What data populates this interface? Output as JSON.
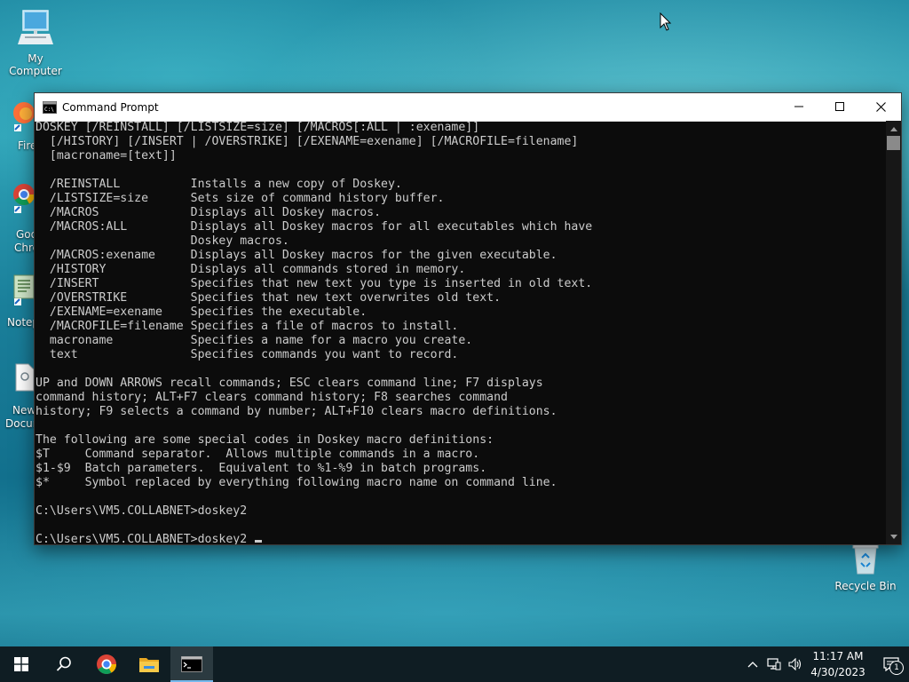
{
  "desktop": {
    "icons": [
      {
        "label": "My Computer"
      },
      {
        "label": "Recycle Bin"
      }
    ],
    "partial_labels": [
      "Fire",
      "Goo",
      "Chro",
      "Notep",
      "New",
      "Docun"
    ]
  },
  "window": {
    "title": "Command Prompt",
    "console_lines": [
      "DOSKEY [/REINSTALL] [/LISTSIZE=size] [/MACROS[:ALL | :exename]]",
      "  [/HISTORY] [/INSERT | /OVERSTRIKE] [/EXENAME=exename] [/MACROFILE=filename]",
      "  [macroname=[text]]",
      "",
      "  /REINSTALL          Installs a new copy of Doskey.",
      "  /LISTSIZE=size      Sets size of command history buffer.",
      "  /MACROS             Displays all Doskey macros.",
      "  /MACROS:ALL         Displays all Doskey macros for all executables which have",
      "                      Doskey macros.",
      "  /MACROS:exename     Displays all Doskey macros for the given executable.",
      "  /HISTORY            Displays all commands stored in memory.",
      "  /INSERT             Specifies that new text you type is inserted in old text.",
      "  /OVERSTRIKE         Specifies that new text overwrites old text.",
      "  /EXENAME=exename    Specifies the executable.",
      "  /MACROFILE=filename Specifies a file of macros to install.",
      "  macroname           Specifies a name for a macro you create.",
      "  text                Specifies commands you want to record.",
      "",
      "UP and DOWN ARROWS recall commands; ESC clears command line; F7 displays",
      "command history; ALT+F7 clears command history; F8 searches command",
      "history; F9 selects a command by number; ALT+F10 clears macro definitions.",
      "",
      "The following are some special codes in Doskey macro definitions:",
      "$T     Command separator.  Allows multiple commands in a macro.",
      "$1-$9  Batch parameters.  Equivalent to %1-%9 in batch programs.",
      "$*     Symbol replaced by everything following macro name on command line.",
      "",
      "C:\\Users\\VM5.COLLABNET>doskey2",
      ""
    ],
    "prompt_line": "C:\\Users\\VM5.COLLABNET>doskey2 "
  },
  "taskbar": {
    "time": "11:17 AM",
    "date": "4/30/2023",
    "notification_count": "1"
  },
  "colors": {
    "console_bg": "#0c0c0c",
    "console_fg": "#cccccc",
    "taskbar_bg": "#0f1d23",
    "accent": "#76b9ed"
  },
  "icons": [
    "start-icon",
    "search-icon",
    "chrome-icon",
    "file-explorer-icon",
    "command-prompt-icon",
    "chevron-up-icon",
    "network-icon",
    "volume-icon",
    "notification-icon",
    "minimize-icon",
    "maximize-icon",
    "close-icon"
  ]
}
